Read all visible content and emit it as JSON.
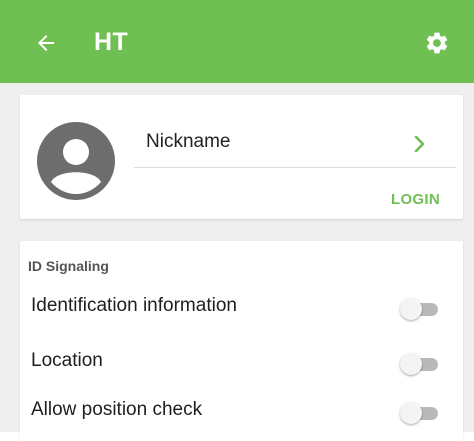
{
  "app_bar": {
    "title": "HT",
    "back_icon": "arrow-left-icon",
    "settings_icon": "gear-icon",
    "color": "#6fbf52"
  },
  "profile": {
    "avatar_icon": "account-circle-icon",
    "nickname_label": "Nickname",
    "chevron_icon": "chevron-right-icon",
    "login_label": "LOGIN",
    "accent_color": "#6fbf52"
  },
  "id_signaling": {
    "section_title": "ID Signaling",
    "settings": [
      {
        "label": "Identification information",
        "enabled": false
      },
      {
        "label": "Location",
        "enabled": false
      },
      {
        "label": "Allow position check",
        "enabled": false
      }
    ]
  }
}
